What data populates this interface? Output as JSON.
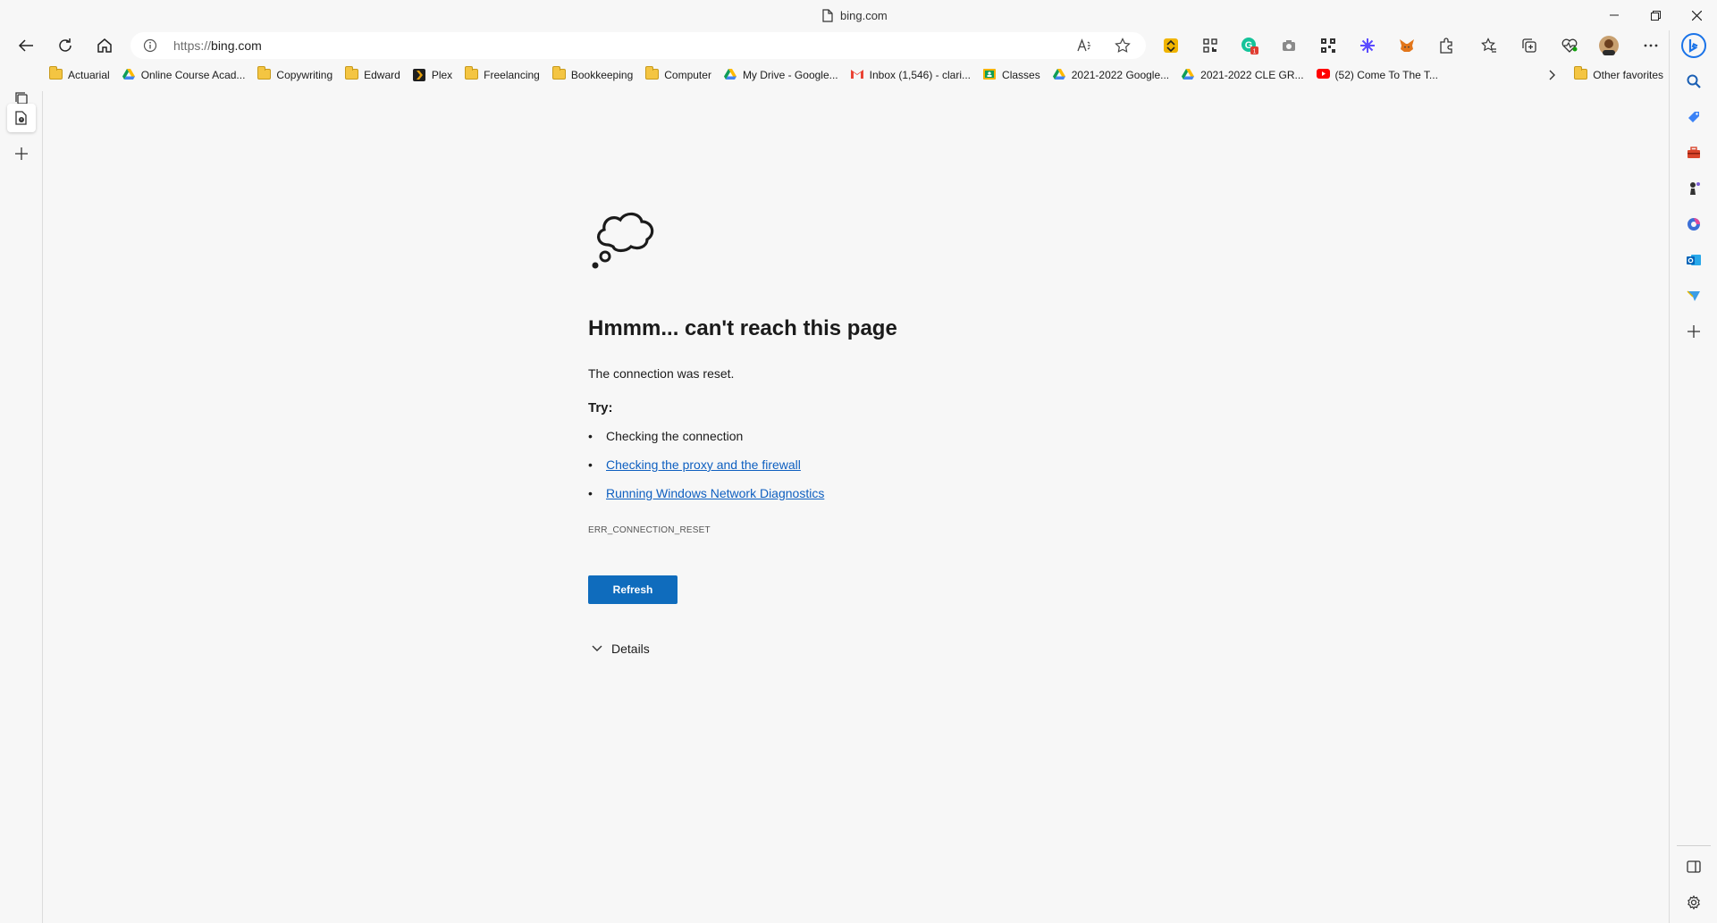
{
  "window": {
    "title": "bing.com",
    "page_icon": "document-icon",
    "controls": [
      "minimize-icon",
      "restore-icon",
      "close-icon"
    ]
  },
  "toolbar": {
    "url_scheme": "https://",
    "url_host": "bing.com",
    "buttons": [
      "back-icon",
      "refresh-icon",
      "home-icon"
    ],
    "address_actions": [
      "read-aloud-icon",
      "favorite-star-icon"
    ],
    "extensions": [
      "honey-extension-icon",
      "qr-scan-icon",
      "grammarly-extension-icon",
      "screenshot-camera-icon",
      "qr-code-icon",
      "sparkle-extension-icon",
      "metamask-fox-icon",
      "extensions-puzzle-icon",
      "favorites-icon",
      "collections-icon",
      "performance-heart-icon",
      "profile-avatar",
      "more-options-icon"
    ]
  },
  "favorites": [
    {
      "label": "Actuarial",
      "icon": "folder-icon"
    },
    {
      "label": "Online Course Acad...",
      "icon": "google-drive-icon"
    },
    {
      "label": "Copywriting",
      "icon": "folder-icon"
    },
    {
      "label": "Edward",
      "icon": "folder-icon"
    },
    {
      "label": "Plex",
      "icon": "plex-icon"
    },
    {
      "label": "Freelancing",
      "icon": "folder-icon"
    },
    {
      "label": "Bookkeeping",
      "icon": "folder-icon"
    },
    {
      "label": "Computer",
      "icon": "folder-icon"
    },
    {
      "label": "My Drive - Google...",
      "icon": "google-drive-icon"
    },
    {
      "label": "Inbox (1,546) - clari...",
      "icon": "gmail-icon"
    },
    {
      "label": "Classes",
      "icon": "google-classroom-icon"
    },
    {
      "label": "2021-2022 Google...",
      "icon": "google-drive-icon"
    },
    {
      "label": "2021-2022 CLE GR...",
      "icon": "google-drive-icon"
    },
    {
      "label": "(52) Come To The T...",
      "icon": "youtube-icon"
    }
  ],
  "other_favorites": "Other favorites",
  "error_page": {
    "title": "Hmmm... can't reach this page",
    "description": "The connection was reset.",
    "try_label": "Try:",
    "items": [
      {
        "text": "Checking the connection",
        "link": false
      },
      {
        "text": "Checking the proxy and the firewall",
        "link": true
      },
      {
        "text": "Running Windows Network Diagnostics",
        "link": true
      }
    ],
    "error_code": "ERR_CONNECTION_RESET",
    "refresh_button": "Refresh",
    "details_label": "Details"
  },
  "colors": {
    "accent": "#0f6cbd",
    "link": "#0e5fc0",
    "background": "#f7f7f7"
  }
}
